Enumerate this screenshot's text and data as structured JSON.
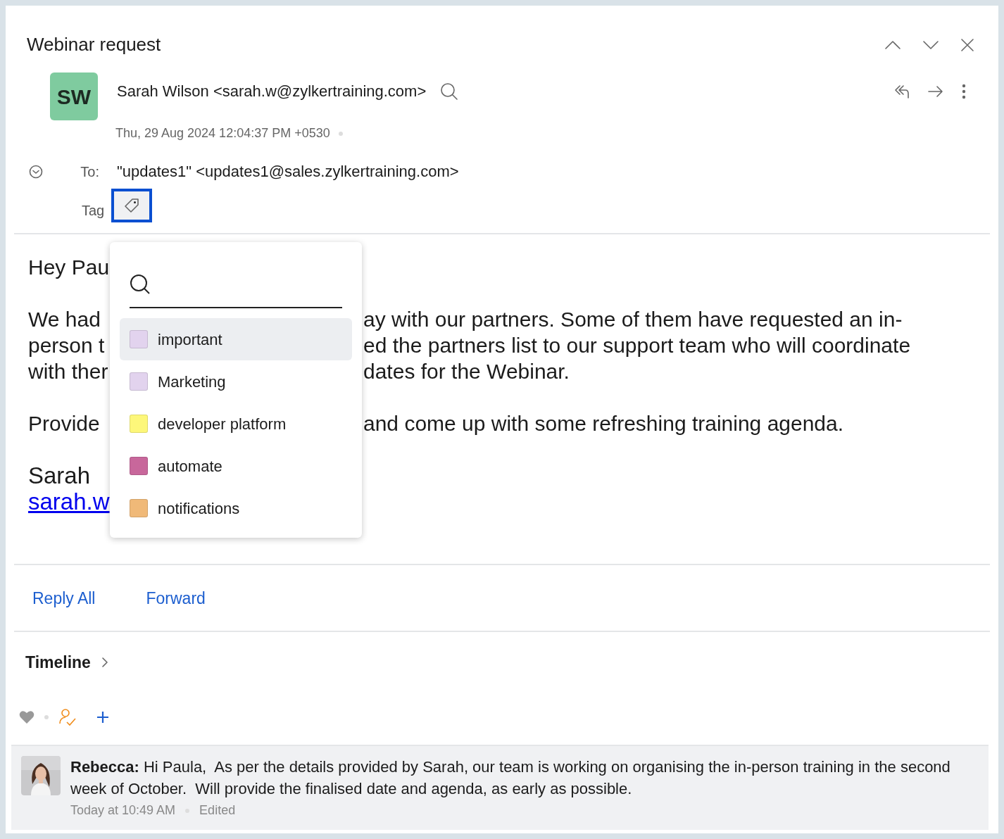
{
  "title": "Webinar request",
  "sender": {
    "initials": "SW",
    "name": "Sarah Wilson <sarah.w@zylkertraining.com>",
    "date": "Thu, 29 Aug 2024 12:04:37 PM +0530"
  },
  "to": {
    "label": "To:",
    "value": "\"updates1\" <updates1@sales.zylkertraining.com>"
  },
  "tag": {
    "label": "Tag",
    "focused": true
  },
  "tag_menu": {
    "items": [
      {
        "label": "important",
        "color": "#e2d3ee",
        "selected": true
      },
      {
        "label": "Marketing",
        "color": "#e2d3ee",
        "selected": false
      },
      {
        "label": "developer platform",
        "color": "#fdf77a",
        "selected": false
      },
      {
        "label": "automate",
        "color": "#c8679b",
        "selected": false
      },
      {
        "label": "notifications",
        "color": "#f0b978",
        "selected": false
      }
    ]
  },
  "body": {
    "paragraphs": [
      {
        "lines": [
          {
            "kind": "text",
            "left": "Hey Pau"
          }
        ]
      },
      {
        "lines": [
          {
            "kind": "text",
            "left": "We had",
            "right": "ay with our partners. Some of them have requested an in-"
          },
          {
            "kind": "text",
            "left": "person t",
            "right": "ed the partners list to our support team who will coordinate"
          },
          {
            "kind": "text",
            "left": "with ther",
            "right": "dates for the Webinar."
          }
        ]
      },
      {
        "lines": [
          {
            "kind": "text",
            "left": "Provide",
            "right": "and come up with some refreshing training agenda."
          }
        ]
      },
      {
        "lines": [
          {
            "kind": "text",
            "left": "Sarah"
          },
          {
            "kind": "link",
            "left": "sarah.w"
          }
        ]
      }
    ]
  },
  "actions": [
    "Reply All",
    "Forward"
  ],
  "timeline": {
    "label": "Timeline"
  },
  "comment": {
    "author": "Rebecca:",
    "text": "Hi Paula,  As per the details provided by Sarah, our team is working on organising the in-person training in the second week of October.  Will provide the finalised date and agenda, as early as possible.",
    "time": "Today at 10:49 AM",
    "status": "Edited"
  }
}
